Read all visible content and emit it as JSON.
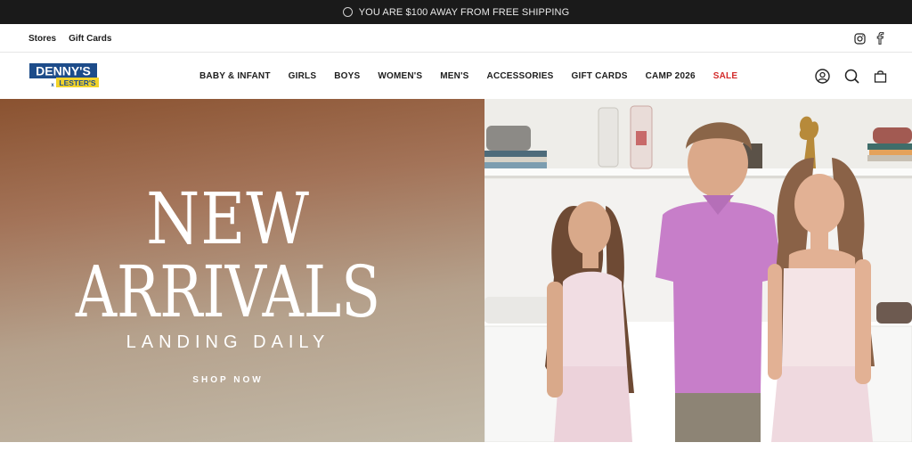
{
  "announcement": {
    "text": "YOU ARE $100 AWAY FROM FREE SHIPPING"
  },
  "utility_links": [
    "Stores",
    "Gift Cards"
  ],
  "logo": {
    "line1": "DENNY'S",
    "connector": "x",
    "line2": "LESTER'S",
    "colors": {
      "navy": "#1d4c8a",
      "yellow": "#f2d32a"
    }
  },
  "menu": [
    "BABY & INFANT",
    "GIRLS",
    "BOYS",
    "WOMEN'S",
    "MEN'S",
    "ACCESSORIES",
    "GIFT CARDS",
    "CAMP 2026",
    "SALE"
  ],
  "menu_accent": "#d32b2b",
  "icons": {
    "social": [
      "instagram-icon",
      "facebook-icon"
    ],
    "actions": [
      "account-icon",
      "search-icon",
      "cart-icon"
    ]
  },
  "hero": {
    "title_line1": "NEW",
    "title_line2": "ARRIVALS",
    "subtitle": "LANDING DAILY",
    "cta": "SHOP NOW"
  }
}
